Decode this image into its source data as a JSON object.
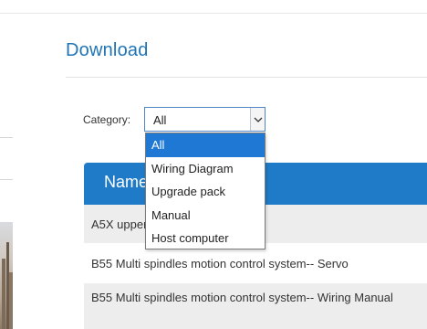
{
  "page": {
    "title": "Download"
  },
  "filter": {
    "label": "Category:",
    "selected": "All",
    "options": [
      "All",
      "Wiring Diagram",
      "Upgrade pack",
      "Manual",
      "Host computer"
    ]
  },
  "table": {
    "header_name": "Name",
    "rows": [
      {
        "name": "A5X upper computer system"
      },
      {
        "name": "B55 Multi spindles motion control system-- Servo"
      },
      {
        "name": "B55 Multi spindles motion control system-- Wiring Manual"
      }
    ]
  },
  "colors": {
    "title": "#1f74b6",
    "table_header": "#1f7bc7",
    "dropdown_highlight": "#1e78d4"
  }
}
